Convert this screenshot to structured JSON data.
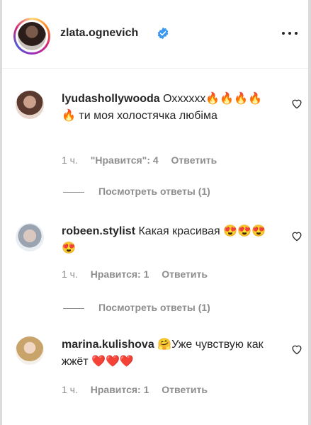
{
  "post": {
    "username": "zlata.ognevich",
    "verified": true
  },
  "comments": [
    {
      "author": "lyudashollywooda",
      "text": "Охххххх🔥🔥🔥🔥🔥 ти моя холостячка любіма",
      "time": "1 ч.",
      "likes": "\"Нравится\": 4",
      "reply": "Ответить",
      "view_replies": "Посмотреть ответы (1)"
    },
    {
      "author": "robeen.stylist",
      "text": "Какая красивая 😍😍😍😍",
      "time": "1 ч.",
      "likes": "Нравится: 1",
      "reply": "Ответить",
      "view_replies": "Посмотреть ответы (1)"
    },
    {
      "author": "marina.kulishova",
      "text": "🤗Уже чувствую как жжёт ❤️❤️❤️",
      "time": "1 ч.",
      "likes": "Нравится: 1",
      "reply": "Ответить"
    }
  ],
  "icons": {
    "verified": "verified-badge-icon",
    "more": "more-options-icon",
    "like": "heart-outline-icon"
  },
  "colors": {
    "verified": "#3897f0",
    "muted": "#8e8e8e",
    "text": "#262626"
  }
}
